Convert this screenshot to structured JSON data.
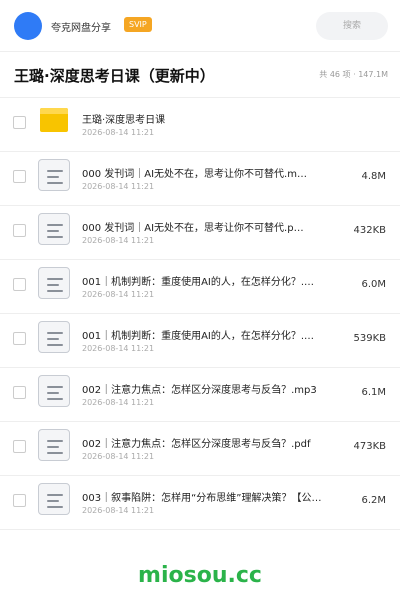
{
  "header": {
    "brand": "夸克网盘分享",
    "badge": "SVIP",
    "search_label": "搜索"
  },
  "folder": {
    "title": "王璐·深度思考日课（更新中）",
    "count": "共 46 项 · 147.1M"
  },
  "items": [
    {
      "name": "王璐·深度思考日课",
      "time": "2026-08-14 11:21",
      "size": "",
      "type": "folder"
    },
    {
      "name": "000 发刊词｜AI无处不在，思考让你不可替代.m…",
      "time": "2026-08-14 11:21",
      "size": "4.8M",
      "type": "file"
    },
    {
      "name": "000 发刊词｜AI无处不在，思考让你不可替代.p…",
      "time": "2026-08-14 11:21",
      "size": "432KB",
      "type": "file"
    },
    {
      "name": "001｜机制判断：重度使用AI的人，在怎样分化？.…",
      "time": "2026-08-14 11:21",
      "size": "6.0M",
      "type": "file"
    },
    {
      "name": "001｜机制判断：重度使用AI的人，在怎样分化？.…",
      "time": "2026-08-14 11:21",
      "size": "539KB",
      "type": "file"
    },
    {
      "name": "002｜注意力焦点：怎样区分深度思考与反刍？.mp3",
      "time": "2026-08-14 11:21",
      "size": "6.1M",
      "type": "file"
    },
    {
      "name": "002｜注意力焦点：怎样区分深度思考与反刍？.pdf",
      "time": "2026-08-14 11:21",
      "size": "473KB",
      "type": "file"
    },
    {
      "name": "003｜叙事陷阱：怎样用“分布思维”理解决策？【公…",
      "time": "2026-08-14 11:21",
      "size": "6.2M",
      "type": "file"
    }
  ],
  "footer": {
    "watermark": "miosou.cc"
  },
  "colors": {
    "accent_blue": "#2f7bf6",
    "svip_orange": "#f5a623",
    "folder_yellow": "#f8c400",
    "watermark_green": "#2bb34a"
  }
}
